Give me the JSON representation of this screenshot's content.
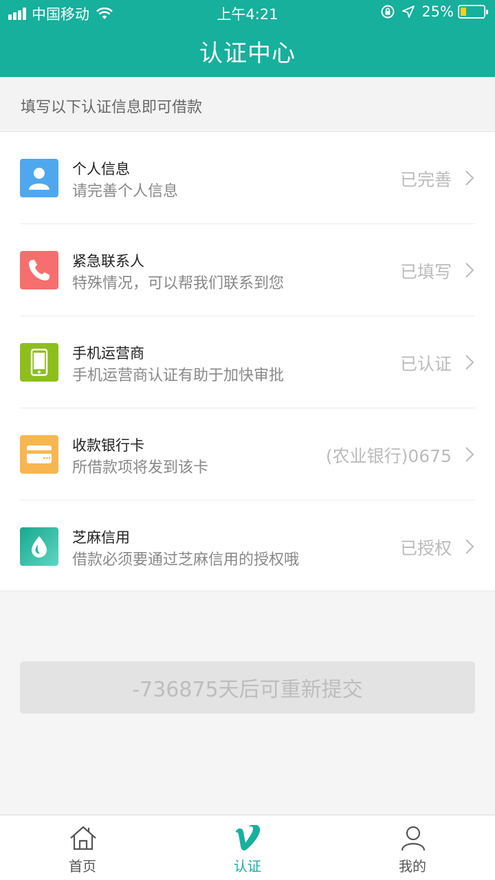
{
  "status_bar": {
    "carrier": "中国移动",
    "time": "上午4:21",
    "battery_percent": "25%",
    "battery_level": 0.25,
    "icons": [
      "signal-icon",
      "wifi-icon",
      "rotation-lock-icon",
      "location-arrow-icon",
      "battery-icon"
    ]
  },
  "header": {
    "title": "认证中心"
  },
  "subheader": {
    "text": "填写以下认证信息即可借款"
  },
  "items": [
    {
      "title": "个人信息",
      "desc": "请完善个人信息",
      "status": "已完善",
      "icon": "person-icon",
      "color": "#4fa8ee"
    },
    {
      "title": "紧急联系人",
      "desc": "特殊情况，可以帮我们联系到您",
      "status": "已填写",
      "icon": "phone-icon",
      "color": "#f66f6f"
    },
    {
      "title": "手机运营商",
      "desc": "手机运营商认证有助于加快审批",
      "status": "已认证",
      "icon": "mobile-icon",
      "color": "#8cbf1b"
    },
    {
      "title": "收款银行卡",
      "desc": "所借款项将发到该卡",
      "status": "(农业银行)0675",
      "icon": "bank-card-icon",
      "color": "#f8b650"
    },
    {
      "title": "芝麻信用",
      "desc": "借款必须要通过芝麻信用的授权哦",
      "status": "已授权",
      "icon": "sesame-credit-icon",
      "color": "#1fb49a"
    }
  ],
  "submit_button": {
    "label": "-736875天后可重新提交"
  },
  "tabs": [
    {
      "label": "首页",
      "icon": "home-icon",
      "active": false
    },
    {
      "label": "认证",
      "icon": "verify-v-icon",
      "active": true
    },
    {
      "label": "我的",
      "icon": "user-icon",
      "active": false
    }
  ],
  "colors": {
    "brand": "#16b09c",
    "background": "#f5f5f5"
  }
}
